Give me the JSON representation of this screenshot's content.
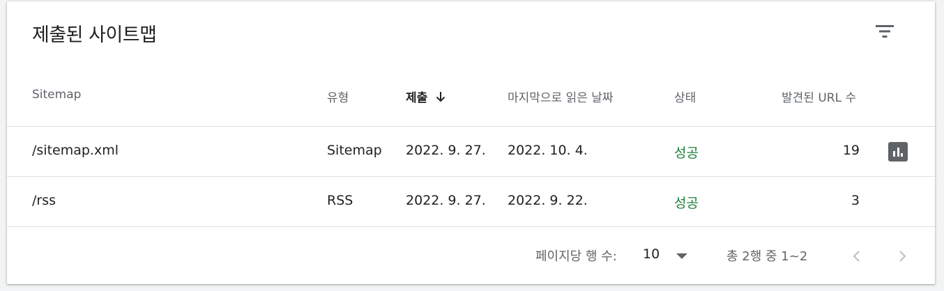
{
  "card": {
    "title": "제출된 사이트맵",
    "filter_icon": "filter-list-icon"
  },
  "table": {
    "headers": {
      "sitemap": "Sitemap",
      "type": "유형",
      "submitted": "제출",
      "last_read": "마지막으로 읽은 날짜",
      "status": "상태",
      "discovered_urls": "발견된 URL 수"
    },
    "sort_icon": "arrow-downward-icon",
    "rows": [
      {
        "sitemap": "/sitemap.xml",
        "type": "Sitemap",
        "submitted": "2022. 9. 27.",
        "last_read": "2022. 10. 4.",
        "status": "성공",
        "discovered_urls": "19",
        "report_icon": "bar-chart-icon"
      },
      {
        "sitemap": "/rss",
        "type": "RSS",
        "submitted": "2022. 9. 27.",
        "last_read": "2022. 9. 22.",
        "status": "성공",
        "discovered_urls": "3"
      }
    ]
  },
  "pagination": {
    "rows_per_page_label": "페이지당 행 수:",
    "rows_per_page_value": "10",
    "range_text": "총 2행 중 1~2",
    "prev_icon": "chevron-left-icon",
    "next_icon": "chevron-right-icon"
  },
  "colors": {
    "status_success": "#188038",
    "text_primary": "#202124",
    "text_secondary": "#5f6368",
    "divider": "#e0e0e0",
    "disabled": "#bdc1c6"
  }
}
